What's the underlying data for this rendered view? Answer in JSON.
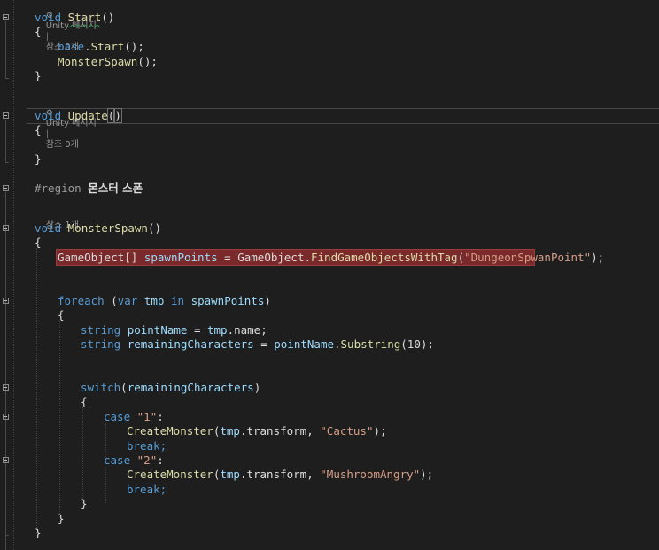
{
  "code_lens": {
    "start": {
      "icon": "unity-icon",
      "label": "Unity 메시지",
      "divider": "|",
      "refs": "참조 0개"
    },
    "update": {
      "icon": "unity-icon",
      "label": "Unity 메시지",
      "divider": "|",
      "refs": "참조 0개"
    },
    "monster_spawn": {
      "refs": "참조 1개"
    }
  },
  "code": {
    "start_void": "void",
    "start_name": "Start",
    "start_parens": "()",
    "open_brace": "{",
    "close_brace": "}",
    "base_kw": "base",
    "base_rest": ".",
    "base_call": "Start",
    "base_end": "();",
    "spawn_call": "MonsterSpawn",
    "spawn_end": "();",
    "update_void": "void",
    "update_name": "Update",
    "update_open": "(",
    "update_close": ")",
    "region_directive": "#region",
    "region_name": "몬스터 스폰",
    "ms_void": "void",
    "ms_name": "MonsterSpawn",
    "ms_parens": "()",
    "l1_type": "GameObject",
    "l1_a": "[] ",
    "l1_var": "spawnPoints",
    "l1_b": " = GameObject.",
    "l1_fn": "FindGameObjectsWithTag",
    "l1_c": "(",
    "l1_str": "\"DungeonSpwanPoint\"",
    "l1_d": ");",
    "fe_kw": "foreach",
    "fe_a": " (",
    "fe_var_kw": "var",
    "fe_b": " ",
    "fe_tmp": "tmp",
    "fe_c": " ",
    "fe_in": "in",
    "fe_d": " ",
    "fe_sp": "spawnPoints",
    "fe_e": ")",
    "s1_kw": "string",
    "s1_a": " ",
    "s1_var": "pointName",
    "s1_b": " = ",
    "s1_tmp": "tmp",
    "s1_c": ".name;",
    "s2_kw": "string",
    "s2_a": " ",
    "s2_var": "remainingCharacters",
    "s2_b": " = ",
    "s2_pn": "pointName",
    "s2_c": ".",
    "s2_fn": "Substring",
    "s2_d": "(10);",
    "sw_kw": "switch",
    "sw_a": "(",
    "sw_var": "remainingCharacters",
    "sw_b": ")",
    "c1_kw": "case",
    "c1_a": " ",
    "c1_str": "\"1\"",
    "c1_b": ":",
    "cm1_fn": "CreateMonster",
    "cm1_a": "(",
    "cm1_tmp": "tmp",
    "cm1_b": ".transform, ",
    "cm1_str": "\"Cactus\"",
    "cm1_c": ");",
    "br1": "break;",
    "c2_kw": "case",
    "c2_a": " ",
    "c2_str": "\"2\"",
    "c2_b": ":",
    "cm2_fn": "CreateMonster",
    "cm2_a": "(",
    "cm2_tmp": "tmp",
    "cm2_b": ".transform, ",
    "cm2_str": "\"MushroomAngry\"",
    "cm2_c": ");",
    "br2": "break;"
  },
  "colors": {
    "background": "#1e1e1e",
    "keyword": "#569cd6",
    "method": "#dcdcaa",
    "identifier": "#9cdcfe",
    "string": "#d69d85",
    "error_highlight": "#7a2a2a"
  }
}
